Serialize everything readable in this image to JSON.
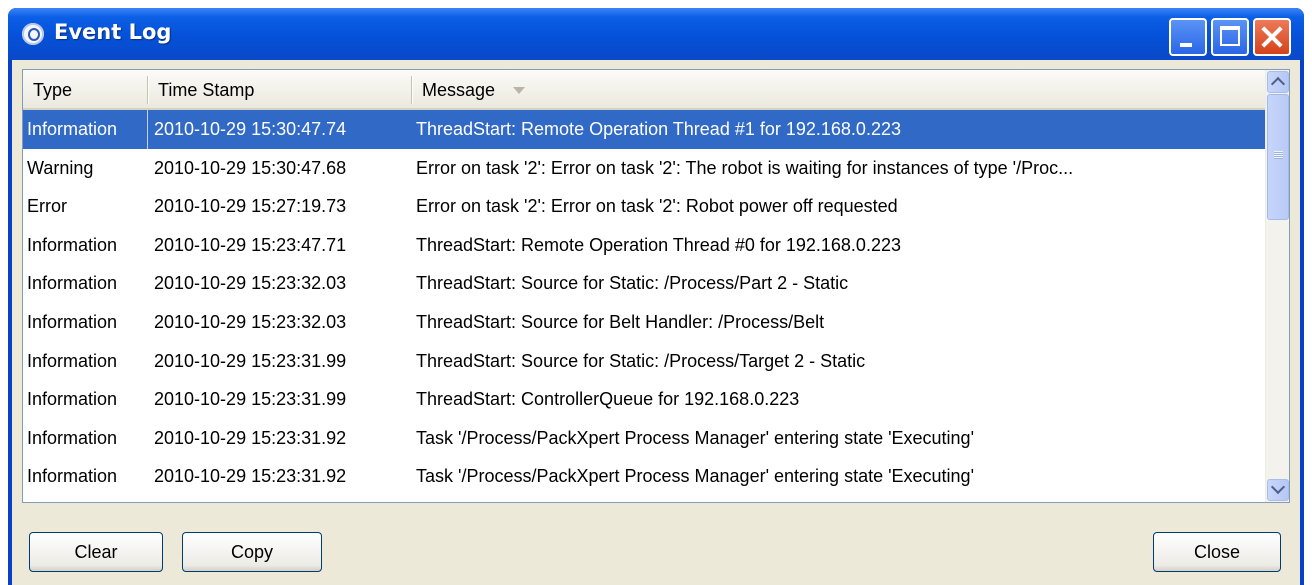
{
  "window": {
    "title": "Event Log"
  },
  "list": {
    "columns": [
      "Type",
      "Time Stamp",
      "Message"
    ],
    "rows": [
      {
        "type": "Information",
        "time": "2010-10-29 15:30:47.74",
        "message": "ThreadStart: Remote Operation Thread #1 for 192.168.0.223"
      },
      {
        "type": "Warning",
        "time": "2010-10-29 15:30:47.68",
        "message": "Error on task '2': Error on task '2': The robot is waiting for instances of type '/Proc..."
      },
      {
        "type": "Error",
        "time": "2010-10-29 15:27:19.73",
        "message": "Error on task '2': Error on task '2': Robot power off requested"
      },
      {
        "type": "Information",
        "time": "2010-10-29 15:23:47.71",
        "message": "ThreadStart: Remote Operation Thread #0 for 192.168.0.223"
      },
      {
        "type": "Information",
        "time": "2010-10-29 15:23:32.03",
        "message": "ThreadStart: Source for Static: /Process/Part 2 - Static"
      },
      {
        "type": "Information",
        "time": "2010-10-29 15:23:32.03",
        "message": "ThreadStart: Source for Belt Handler: /Process/Belt"
      },
      {
        "type": "Information",
        "time": "2010-10-29 15:23:31.99",
        "message": "ThreadStart: Source for Static: /Process/Target 2 - Static"
      },
      {
        "type": "Information",
        "time": "2010-10-29 15:23:31.99",
        "message": "ThreadStart: ControllerQueue for 192.168.0.223"
      },
      {
        "type": "Information",
        "time": "2010-10-29 15:23:31.92",
        "message": "Task '/Process/PackXpert Process Manager' entering state 'Executing'"
      },
      {
        "type": "Information",
        "time": "2010-10-29 15:23:31.92",
        "message": "Task '/Process/PackXpert Process Manager' entering state 'Executing'"
      }
    ]
  },
  "buttons": {
    "clear": "Clear",
    "copy": "Copy",
    "close": "Close"
  },
  "colors": {
    "title_bar": "#0551d8",
    "selection": "#3169c6",
    "close_button": "#d4421a"
  },
  "icons": [
    "app-icon",
    "minimize-icon",
    "maximize-icon",
    "close-icon",
    "sort-descending-icon",
    "scroll-up-icon",
    "scroll-down-icon"
  ]
}
